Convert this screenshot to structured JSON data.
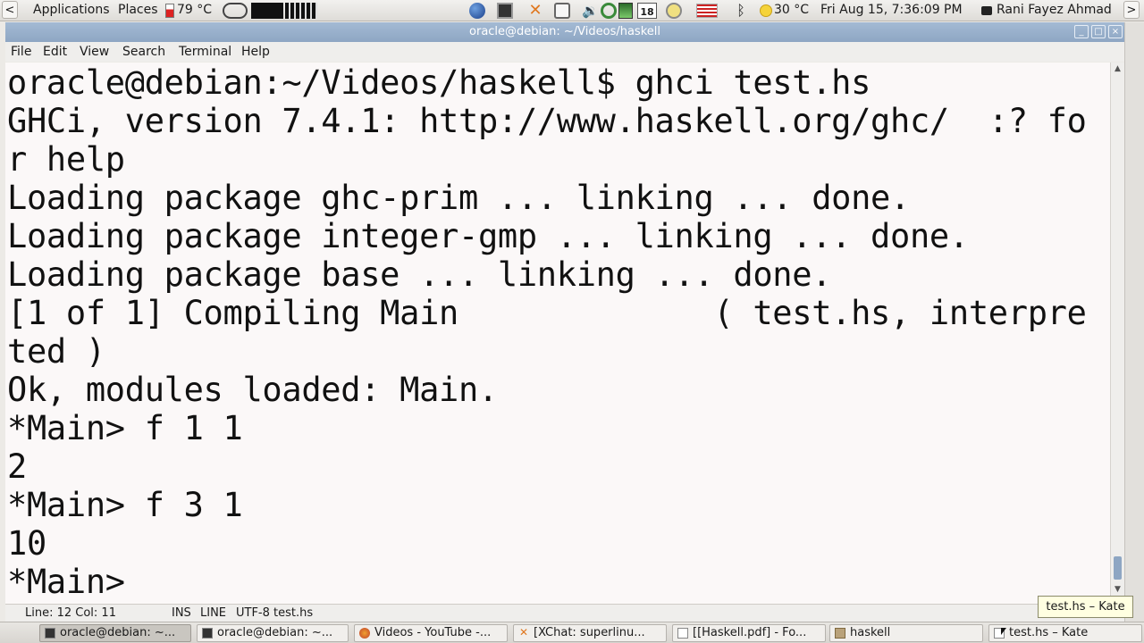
{
  "top_panel": {
    "menu_applications": "Applications",
    "menu_places": "Places",
    "weather_left": "79 °C",
    "weather_right": "30 °C",
    "calendar_day": "18",
    "clock": "Fri Aug 15,  7:36:09 PM",
    "user": "Rani Fayez Ahmad",
    "left_arrow": "<",
    "right_arrow": ">"
  },
  "window": {
    "title": "oracle@debian: ~/Videos/haskell",
    "btn_minimize": "_",
    "btn_maximize": "□",
    "btn_close": "×"
  },
  "menubar": {
    "file": "File",
    "edit": "Edit",
    "view": "View",
    "search": "Search",
    "terminal": "Terminal",
    "help": "Help"
  },
  "terminal": {
    "lines": [
      "oracle@debian:~/Videos/haskell$ ghci test.hs",
      "GHCi, version 7.4.1: http://www.haskell.org/ghc/  :? fo",
      "r help",
      "Loading package ghc-prim ... linking ... done.",
      "Loading package integer-gmp ... linking ... done.",
      "Loading package base ... linking ... done.",
      "[1 of 1] Compiling Main             ( test.hs, interpre",
      "ted )",
      "Ok, modules loaded: Main.",
      "*Main> f 1 1",
      "2",
      "*Main> f 3 1",
      "10",
      "*Main> "
    ]
  },
  "statusbar": {
    "position": "Line: 12 Col: 11",
    "mode_ins": "INS",
    "mode_line": "LINE",
    "encoding_file": "UTF-8 test.hs"
  },
  "tooltip": "test.hs – Kate",
  "taskbar": {
    "tasks": [
      "oracle@debian: ~...",
      "oracle@debian: ~...",
      "Videos - YouTube -...",
      "[XChat: superlinu...",
      "[[Haskell.pdf] - Fo...",
      "haskell",
      "test.hs – Kate"
    ]
  },
  "colors": {
    "titlebar": "#8ea6c3",
    "terminal_bg": "#fbf8f8",
    "terminal_fg": "#111111"
  }
}
